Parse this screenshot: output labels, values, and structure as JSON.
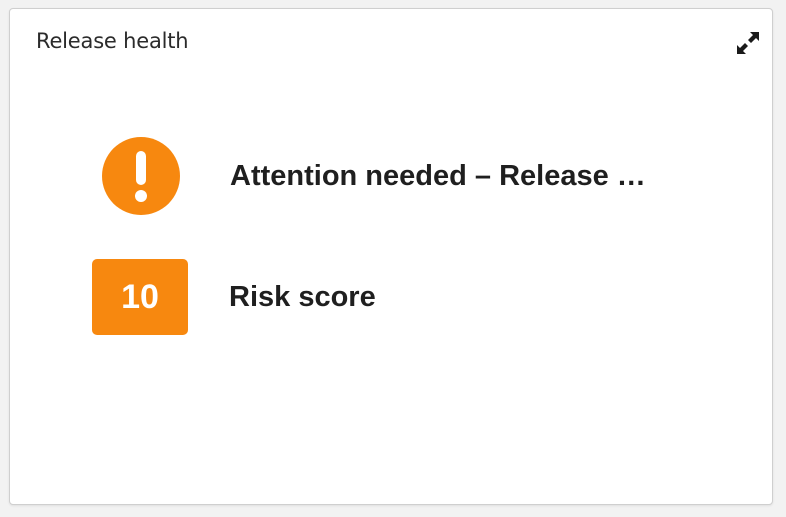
{
  "widget": {
    "title": "Release health",
    "expand_icon": "expand-arrows-icon",
    "accent_color": "#f7880f"
  },
  "status": {
    "icon": "exclamation-icon",
    "text": "Attention needed – Release …"
  },
  "risk": {
    "score": "10",
    "label": "Risk score"
  }
}
